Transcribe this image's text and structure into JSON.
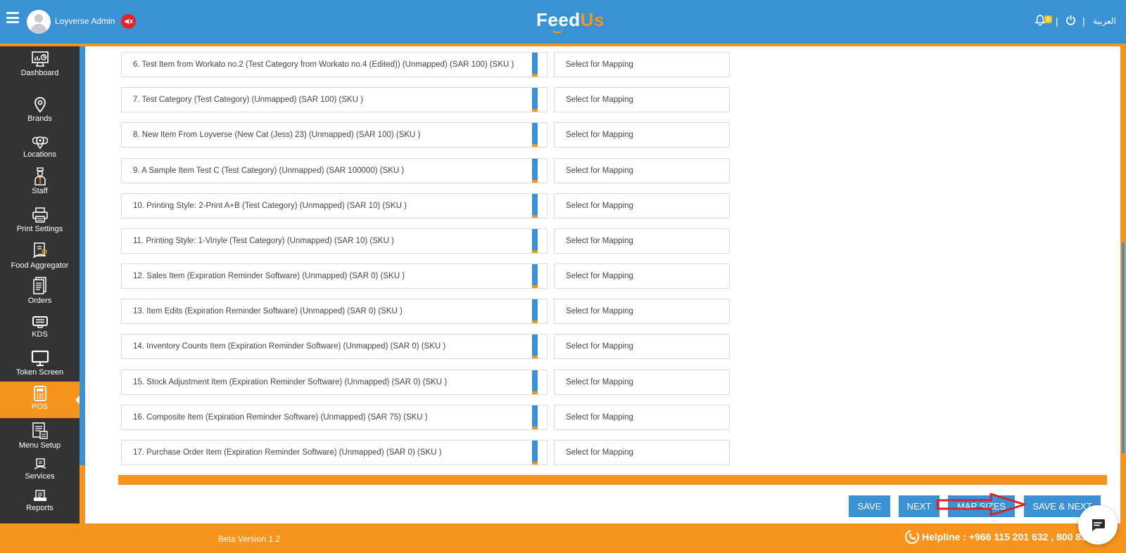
{
  "header": {
    "user_name": "Loyverse Admin",
    "logo_main": "Feed",
    "logo_accent": "Us",
    "notification_count": "0",
    "language": "العربية",
    "separator": "|"
  },
  "sidebar": {
    "items": [
      {
        "label": "Dashboard",
        "icon": "dashboard-icon"
      },
      {
        "label": "Brands",
        "icon": "map-pin-icon"
      },
      {
        "label": "Locations",
        "icon": "locations-icon"
      },
      {
        "label": "Staff",
        "icon": "staff-icon"
      },
      {
        "label": "Print Settings",
        "icon": "printer-icon"
      },
      {
        "label": "Food Aggregator",
        "icon": "food-aggregator-icon"
      },
      {
        "label": "Orders",
        "icon": "orders-icon"
      },
      {
        "label": "KDS",
        "icon": "kds-icon"
      },
      {
        "label": "Token Screen",
        "icon": "monitor-icon"
      },
      {
        "label": "POS",
        "icon": "calculator-icon",
        "active": true
      },
      {
        "label": "Menu Setup",
        "icon": "menu-setup-icon"
      },
      {
        "label": "Services",
        "icon": "services-icon"
      },
      {
        "label": "Reports",
        "icon": "reports-icon"
      }
    ]
  },
  "mapping": {
    "select_placeholder": "Select for Mapping",
    "items": [
      "6. Test Item from Workato no.2 (Test Category from Workato no.4 (Edited)) (Unmapped) (SAR 100) (SKU )",
      "7. Test Category (Test Category) (Unmapped) (SAR 100) (SKU )",
      "8. New Item From Loyverse (New Cat (Jess) 23) (Unmapped) (SAR 100) (SKU )",
      "9. A Sample Item Test C (Test Category) (Unmapped) (SAR 100000) (SKU )",
      "10. Printing Style: 2-Print A+B (Test Category) (Unmapped) (SAR 10) (SKU )",
      "11. Printing Style: 1-Vinyle (Test Category) (Unmapped) (SAR 10) (SKU )",
      "12. Sales Item (Expiration Reminder Software) (Unmapped) (SAR 0) (SKU )",
      "13. Item Edits (Expiration Reminder Software) (Unmapped) (SAR 0) (SKU )",
      "14. Inventory Counts Item (Expiration Reminder Software) (Unmapped) (SAR 0) (SKU )",
      "15. Stock Adjustment Item (Expiration Reminder Software) (Unmapped) (SAR 0) (SKU )",
      "16. Composite Item (Expiration Reminder Software) (Unmapped) (SAR 75) (SKU )",
      "17. Purchase Order Item (Expiration Reminder Software) (Unmapped) (SAR 0) (SKU )"
    ]
  },
  "actions": {
    "save": "SAVE",
    "next": "NEXT",
    "map_sizes": "MAP SIZES",
    "save_next": "SAVE & NEXT"
  },
  "footer": {
    "version": "Beta Version 1.2",
    "helpline_label": "Helpline :",
    "helpline_numbers": "+966 115 201 632 , 800 85"
  },
  "colors": {
    "primary_blue": "#3a92d4",
    "accent_orange": "#f7941d",
    "sidebar_dark": "#333333",
    "annotation_red": "#d8232a"
  }
}
